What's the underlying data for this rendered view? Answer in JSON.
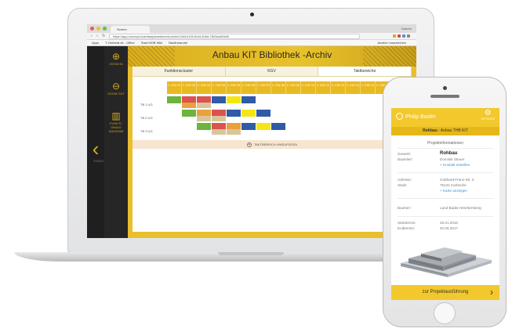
{
  "laptop": {
    "browser": {
      "tab_title": "Screen",
      "window_user": "Gaereo",
      "url": "https://app.concept.io/anbauplanelement-archiv/1/tbl-k105-fe4d-406d-7803ca8f1b8f",
      "bookmarks": [
        "Apps",
        "T-Gerbeat de - Office",
        "Start MOB Wiki",
        "Baufirmaruhe"
      ],
      "bookmarks_other": "Andere Lesezeichen"
    },
    "sidebar": {
      "zoom_in": "ZOOM IN",
      "zoom_out": "ZOOM OUT",
      "function_label": "FUNKTI- ONALE DIAGRAM",
      "back": "ZURÜCK"
    },
    "title": "Anbau KIT Bibliothek -Archiv",
    "tabs": [
      "Funktionscluster",
      "KGV",
      "Taktbereiche"
    ],
    "weeks": [
      "1. KW 01",
      "1. KW 02",
      "1. KW 03",
      "1. KW 04",
      "1. KW 05",
      "1. KW 06",
      "1. KW 07",
      "1. KW 08",
      "1. KW 09",
      "1. KW 10",
      "1. KW 11",
      "1. KW 12",
      "1. KW 13",
      "1. KW 14",
      "1. KW 15"
    ],
    "rows": [
      "TB 1 UG",
      "TB 2 UG",
      "TB 3 UG"
    ],
    "add_label": "TAKTBEREICH HINZUFÜGEN",
    "colors": {
      "accent": "#E9BF2E",
      "green": "#6DB33F",
      "red": "#D9534F",
      "orange": "#E9A13B",
      "blue": "#2F5BA8",
      "yellow": "#F6E514",
      "tan": "#D8C69A"
    }
  },
  "phone": {
    "user_name": "Philip Basler",
    "gear_label": "SETTINGS",
    "subtitle_bold": "Rohbau",
    "subtitle_rest": " - Anbau THB KIT",
    "section": "Projektinformationen",
    "gewerk_label": "Gewerk:",
    "gewerk_value": "Rohbau",
    "bauleiter_label": "Bauleiter:",
    "bauleiter_value": "Dominik Steuer",
    "kontakt_link": "+ Kontakt erstellen",
    "adresse_label": "Adresse:",
    "adresse_value": "Gotthard-Franz-Str. 3",
    "stadt_label": "Stadt:",
    "stadt_value": "76131 Karlsruhe",
    "karte_link": "+ Karte anzeigen",
    "bauherr_label": "Bauherr:",
    "bauherr_value": "Land Baden-Württemberg",
    "start_label": "Starttermin:",
    "start_value": "25.01.2016",
    "end_label": "Endtermin:",
    "end_value": "20.06.2017",
    "button": "zur Projektausführung"
  }
}
